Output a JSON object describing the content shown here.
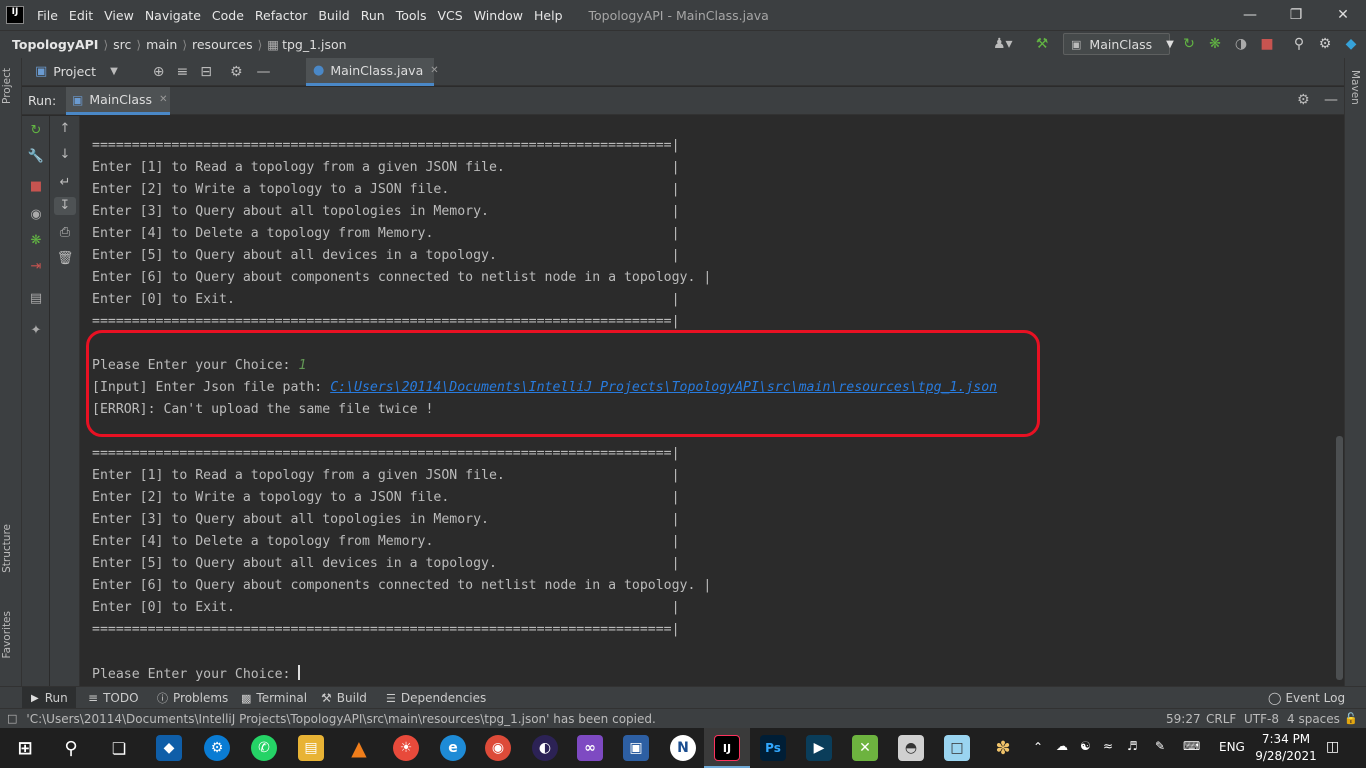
{
  "app": {
    "logo": "IJ",
    "window_title": "TopologyAPI - MainClass.java"
  },
  "menu": [
    "File",
    "Edit",
    "View",
    "Navigate",
    "Code",
    "Refactor",
    "Build",
    "Run",
    "Tools",
    "VCS",
    "Window",
    "Help"
  ],
  "breadcrumb": [
    "TopologyAPI",
    "src",
    "main",
    "resources",
    "tpg_1.json"
  ],
  "toolbar": {
    "run_config": "MainClass"
  },
  "project_panel": {
    "label": "Project"
  },
  "editor_tab": {
    "label": "MainClass.java"
  },
  "run_panel": {
    "label": "Run:",
    "tab": "MainClass"
  },
  "side_tabs": {
    "project": "Project",
    "structure": "Structure",
    "favorites": "Favorites",
    "maven": "Maven"
  },
  "console": {
    "separator": "=========================================================================|",
    "menu_lines": [
      "Enter [1] to Read a topology from a given JSON file.                     |",
      "Enter [2] to Write a topology to a JSON file.                            |",
      "Enter [3] to Query about all topologies in Memory.                       |",
      "Enter [4] to Delete a topology from Memory.                              |",
      "Enter [5] to Query about all devices in a topology.                      |",
      "Enter [6] to Query about components connected to netlist node in a topology. |",
      "Enter [0] to Exit.                                                       |"
    ],
    "prompt": "Please Enter your Choice: ",
    "choice_input": "1",
    "input_prompt": "[Input] Enter Json file path: ",
    "input_path": "C:\\Users\\20114\\Documents\\IntelliJ Projects\\TopologyAPI\\src\\main\\resources\\tpg_1.json",
    "error": "[ERROR]: Can't upload the same file twice !",
    "final_prompt": "Please Enter your Choice: "
  },
  "tool_windows": {
    "run": "Run",
    "todo": "TODO",
    "problems": "Problems",
    "terminal": "Terminal",
    "build": "Build",
    "dependencies": "Dependencies",
    "event_log": "Event Log"
  },
  "status": {
    "message": "'C:\\Users\\20114\\Documents\\IntelliJ Projects\\TopologyAPI\\src\\main\\resources\\tpg_1.json' has been copied.",
    "position": "59:27",
    "line_sep": "CRLF",
    "encoding": "UTF-8",
    "indent": "4 spaces"
  },
  "taskbar": {
    "language": "ENG",
    "time": "7:34 PM",
    "date": "9/28/2021"
  },
  "colors": {
    "accent": "#4a88c7",
    "highlight_border": "#e81123",
    "link": "#287bde",
    "input_green": "#629755"
  }
}
